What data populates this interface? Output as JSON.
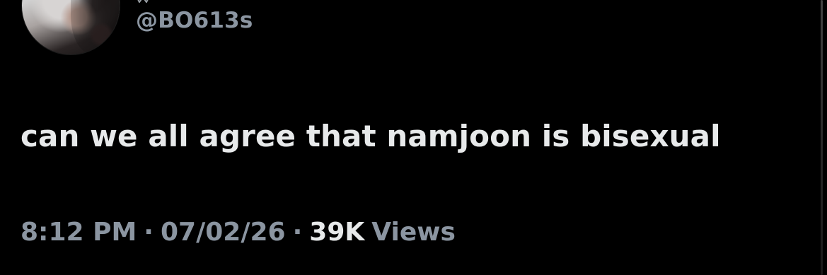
{
  "tweet": {
    "handle": "@BO613s",
    "text": "can we all agree that namjoon is bisexual",
    "time": "8:12 PM",
    "date": "07/02/26",
    "views_count": "39K",
    "views_label": "Views",
    "separator": "·"
  },
  "icons": {
    "avatar": "profile-avatar",
    "badge": "badge-icon"
  },
  "colors": {
    "background": "#000000",
    "primary_text": "#e7e9ea",
    "secondary_text": "#8b95a1"
  }
}
